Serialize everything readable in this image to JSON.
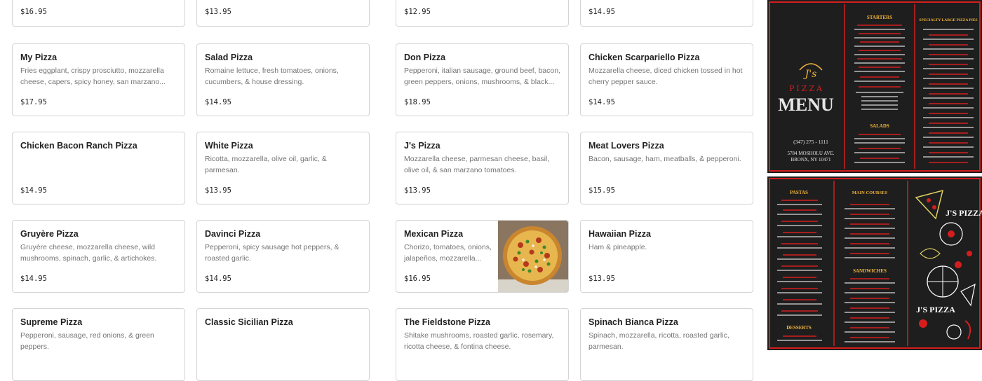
{
  "menu_items": {
    "r0c0": {
      "price": "$16.95"
    },
    "r0c1": {
      "price": "$13.95"
    },
    "r0c2": {
      "price": "$12.95"
    },
    "r0c3": {
      "price": "$14.95"
    },
    "r1c0": {
      "name": "My Pizza",
      "description": "Fries eggplant, crispy prosciutto, mozzarella cheese, capers, spicy honey, san marzano...",
      "price": "$17.95"
    },
    "r1c1": {
      "name": "Salad Pizza",
      "description": "Romaine lettuce, fresh tomatoes, onions, cucumbers, & house dressing.",
      "price": "$14.95"
    },
    "r1c2": {
      "name": "Don Pizza",
      "description": "Pepperoni, italian sausage, ground beef, bacon, green peppers, onions, mushrooms, & black...",
      "price": "$18.95"
    },
    "r1c3": {
      "name": "Chicken Scarpariello Pizza",
      "description": "Mozzarella cheese, diced chicken tossed in hot cherry pepper sauce.",
      "price": "$14.95"
    },
    "r2c0": {
      "name": "Chicken Bacon Ranch Pizza",
      "description": "",
      "price": "$14.95"
    },
    "r2c1": {
      "name": "White Pizza",
      "description": "Ricotta, mozzarella, olive oil, garlic, & parmesan.",
      "price": "$13.95"
    },
    "r2c2": {
      "name": "J's Pizza",
      "description": "Mozzarella cheese, parmesan cheese, basil, olive oil, & san marzano tomatoes.",
      "price": "$13.95"
    },
    "r2c3": {
      "name": "Meat Lovers Pizza",
      "description": "Bacon, sausage, ham, meatballs, & pepperoni.",
      "price": "$15.95"
    },
    "r3c0": {
      "name": "Gruyère Pizza",
      "description": "Gruyère cheese, mozzarella cheese, wild mushrooms, spinach, garlic, & artichokes.",
      "price": "$14.95"
    },
    "r3c1": {
      "name": "Davinci Pizza",
      "description": "Pepperoni, spicy sausage hot peppers, & roasted garlic.",
      "price": "$14.95"
    },
    "r3c2": {
      "name": "Mexican Pizza",
      "description": "Chorizo, tomatoes, onions, jalapeños, mozzarella...",
      "price": "$16.95"
    },
    "r3c3": {
      "name": "Hawaiian Pizza",
      "description": "Ham & pineapple.",
      "price": "$13.95"
    },
    "r4c0": {
      "name": "Supreme Pizza",
      "description": "Pepperoni, sausage, red onions, & green peppers."
    },
    "r4c1": {
      "name": "Classic Sicilian Pizza",
      "description": ""
    },
    "r4c2": {
      "name": "The Fieldstone Pizza",
      "description": "Shitake mushrooms, roasted garlic, rosemary, ricotta cheese, & fontina cheese."
    },
    "r4c3": {
      "name": "Spinach Bianca Pizza",
      "description": "Spinach, mozzarella, ricotta, roasted garlic, parmesan."
    }
  },
  "menu_image_top": {
    "brand": "J's",
    "subtitle": "PIZZA",
    "title": "MENU",
    "phone": "(347) 275 - 1111",
    "address_line1": "5784 MOSHOLU AVE.",
    "address_line2": "BRONX, NY 10471",
    "section_starters": "STARTERS",
    "section_specialty": "SPECIALTY LARGE PIZZA PIES",
    "section_salads": "SALADS"
  },
  "menu_image_bottom": {
    "section_pastas": "PASTAS",
    "section_main": "MAIN COURSES",
    "section_sandwiches": "SANDWICHES",
    "section_desserts": "DESSERTS",
    "brand_top": "J'S PIZZA",
    "brand_bottom": "J'S PIZZA"
  },
  "colors": {
    "card_border": "#d4d4d4",
    "name_text": "#222222",
    "description_text": "#757575",
    "menu_background": "#1e1e1e",
    "menu_accent_red": "#d41e1e",
    "menu_accent_gold": "#f2b53a"
  }
}
